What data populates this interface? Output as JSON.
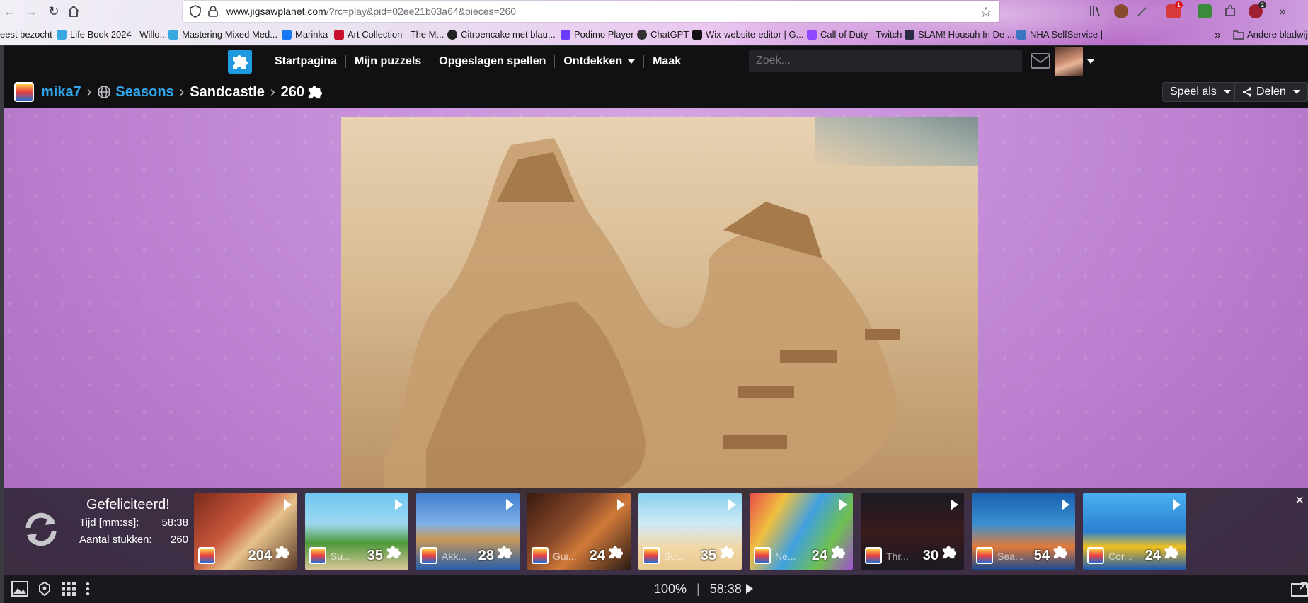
{
  "browser": {
    "url_host": "www.jigsawplanet.com",
    "url_path": "/?rc=play&pid=02ee21b03a64&pieces=260",
    "bookmarks": [
      {
        "label": "eest bezocht",
        "color": "#5a5a60"
      },
      {
        "label": "Life Book 2024 - Willo...",
        "color": "#3aa8e0"
      },
      {
        "label": "Mastering Mixed Med...",
        "color": "#3aa8e0"
      },
      {
        "label": "Marinka",
        "color": "#1877f2"
      },
      {
        "label": "Art Collection - The M...",
        "color": "#c8102e"
      },
      {
        "label": "Citroencake met blau...",
        "color": "#222222"
      },
      {
        "label": "Podimo Player",
        "color": "#6b3cff"
      },
      {
        "label": "ChatGPT",
        "color": "#333333"
      },
      {
        "label": "Wix-website-editor | G...",
        "color": "#111111"
      },
      {
        "label": "Call of Duty - Twitch",
        "color": "#9146ff"
      },
      {
        "label": "SLAM! Housuh In De ...",
        "color": "#2a2a44"
      },
      {
        "label": "NHA SelfService |",
        "color": "#3b76c4"
      }
    ],
    "more_bookmarks": "»",
    "other_bookmarks": "Andere bladwijz",
    "badges": [
      "1",
      "2"
    ]
  },
  "header": {
    "menu": [
      "Startpagina",
      "Mijn puzzels",
      "Opgeslagen spellen",
      "Ontdekken",
      "Maak"
    ],
    "search_placeholder": "Zoek..."
  },
  "breadcrumb": {
    "user": "mika7",
    "collection": "Seasons",
    "puzzle": "Sandcastle",
    "pieces": "260"
  },
  "actions": {
    "play_as": "Speel als",
    "share": "Delen"
  },
  "completion": {
    "title": "Gefeliciteerd!",
    "time_label": "Tijd [mm:ss]:",
    "time_value": "58:38",
    "pieces_label": "Aantal stukken:",
    "pieces_value": "260",
    "close": "×"
  },
  "thumbnails": [
    {
      "name": "",
      "count": "204",
      "bg": "linear-gradient(135deg,#7a2a1c,#c9573a 40%,#e6c18a 60%,#5a3a2a)"
    },
    {
      "name": "Su...",
      "count": "35",
      "bg": "linear-gradient(180deg,#6fc6f2 0%,#9fd8f0 40%,#4f9a3a 65%,#d9c59a 100%)"
    },
    {
      "name": "Akk...",
      "count": "28",
      "bg": "linear-gradient(180deg,#3f7fd0 0%,#7fb0e6 40%,#c89a5a 60%,#2a5ea8 100%)"
    },
    {
      "name": "Gui...",
      "count": "24",
      "bg": "linear-gradient(135deg,#3a1a10,#8a4a2a 40%,#d07a3a 60%,#2a1a14)"
    },
    {
      "name": "Su...",
      "count": "35",
      "bg": "linear-gradient(180deg,#8ad0f0 0%,#cfeaf5 40%,#f0d8a8 70%,#e8c890 100%)"
    },
    {
      "name": "Ne...",
      "count": "24",
      "bg": "linear-gradient(120deg,#e84a4a,#f0c040 25%,#40a0e0 50%,#70c050 75%,#a050d0)"
    },
    {
      "name": "Thr...",
      "count": "30",
      "bg": "linear-gradient(180deg,#1a1a24 0%,#3a1a1a 50%,#1a1a24 100%)"
    },
    {
      "name": "Sea...",
      "count": "54",
      "bg": "linear-gradient(180deg,#1a60b0 0%,#3a90d0 40%,#e07a3a 70%,#1a4a90 100%)"
    },
    {
      "name": "Cor...",
      "count": "24",
      "bg": "linear-gradient(180deg,#4ab0f0 0%,#2a80d0 50%,#f0c020 70%,#1a5ab0 100%)"
    }
  ],
  "toolbar": {
    "zoom": "100%",
    "divider": "|",
    "timer": "58:38"
  }
}
